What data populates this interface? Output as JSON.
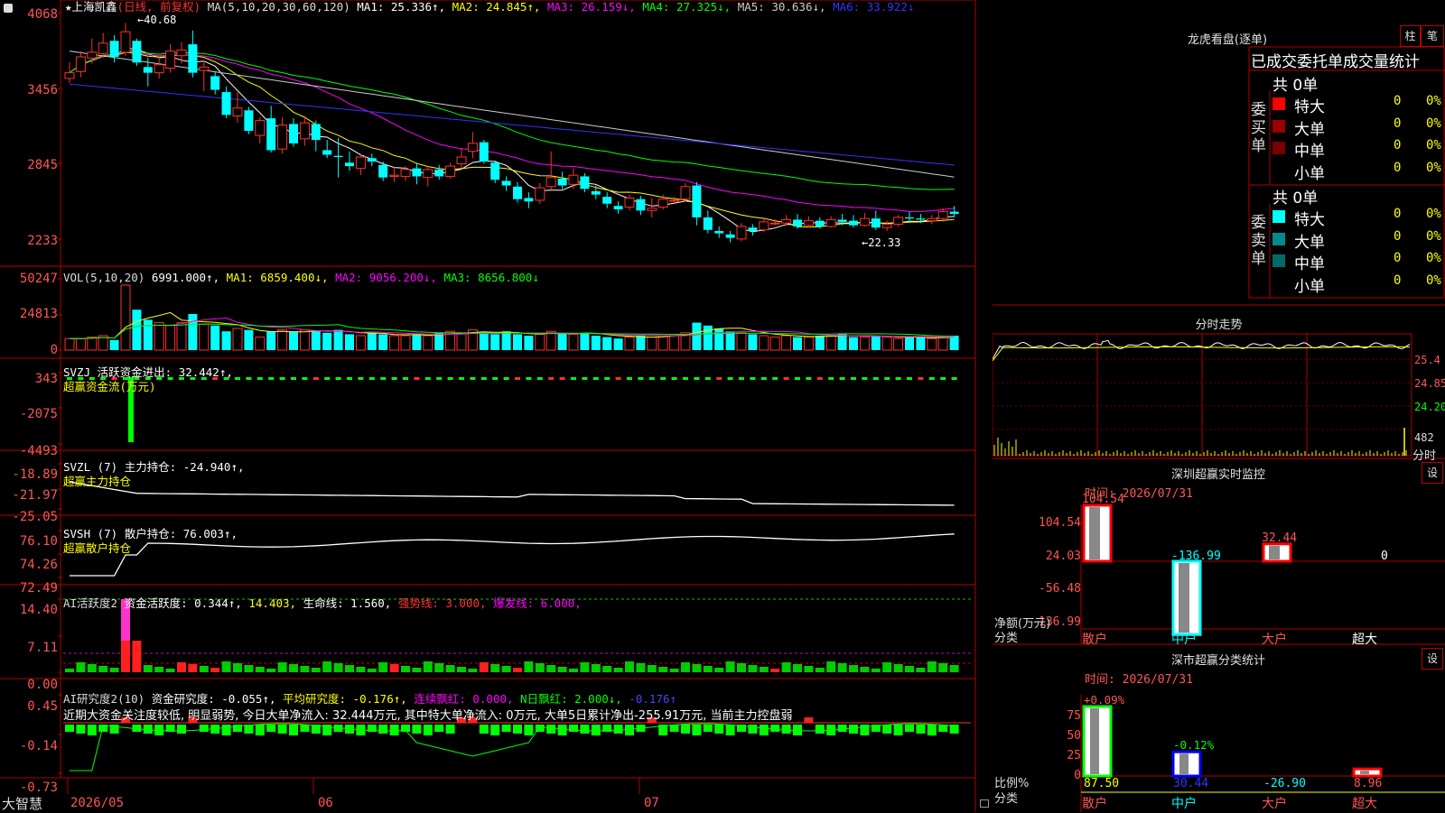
{
  "header": {
    "icon": "gear-icon",
    "star": "★",
    "stock_name": "上海凯鑫",
    "period_tag": "(日线, 前复权)",
    "ma_label": "MA(5,10,20,30,60,120)",
    "ma_items": [
      {
        "text": "MA1: 25.336↑,",
        "color": "#ffffff"
      },
      {
        "text": "MA2: 24.845↑,",
        "color": "#ffff00"
      },
      {
        "text": "MA3: 26.159↓,",
        "color": "#ff00ff"
      },
      {
        "text": "MA4: 27.325↓,",
        "color": "#00ff00"
      },
      {
        "text": "MA5: 30.636↓,",
        "color": "#cccccc"
      },
      {
        "text": "MA6: 33.922↓",
        "color": "#3333ff"
      }
    ]
  },
  "price_axis": [
    "4068",
    "3456",
    "2845",
    "2233"
  ],
  "high_label": "40.68",
  "low_label": "22.33",
  "volume_panel": {
    "axis": [
      "50247",
      "24813",
      "0"
    ],
    "title_items": [
      {
        "text": "VOL(5,10,20)",
        "color": "#dddddd"
      },
      {
        "text": "6991.000↑,",
        "color": "#ffffff"
      },
      {
        "text": "MA1: 6859.400↓,",
        "color": "#ffff00"
      },
      {
        "text": "MA2: 9056.200↓,",
        "color": "#ff00ff"
      },
      {
        "text": "MA3: 8656.800↓",
        "color": "#00ff00"
      }
    ]
  },
  "svzj_panel": {
    "axis": [
      "343",
      "-2075",
      "-4493"
    ],
    "title": "SVZJ  活跃资金进出: 32.442↑,",
    "subtitle": "超赢资金流(万元)"
  },
  "svzl_panel": {
    "axis": [
      "-18.89",
      "-21.97",
      "-25.05"
    ],
    "title": "SVZL (7) 主力持仓: -24.940↑,",
    "subtitle": "超赢主力持仓"
  },
  "svsh_panel": {
    "axis": [
      "76.10",
      "74.26",
      "72.49"
    ],
    "title": "SVSH (7) 散户持仓: 76.003↑,",
    "subtitle": "超赢散户持仓"
  },
  "ai_active_panel": {
    "axis": [
      "14.40",
      "7.11",
      "0.00"
    ],
    "title_items": [
      {
        "text": "AI活跃度2",
        "color": "#dddddd"
      },
      {
        "text": "资金活跃度: 0.344↑,",
        "color": "#ffffff"
      },
      {
        "text": "14.403,",
        "color": "#ffff00"
      },
      {
        "text": "生命线: 1.560,",
        "color": "#ffffff"
      },
      {
        "text": "强势线: 3.000,",
        "color": "#ff3333"
      },
      {
        "text": "爆发线: 6.000,",
        "color": "#ff00ff"
      }
    ]
  },
  "ai_research_panel": {
    "axis": [
      "0.45",
      "-0.14",
      "-0.73"
    ],
    "title_items": [
      {
        "text": "AI研究度2(10)",
        "color": "#dddddd"
      },
      {
        "text": "资金研究度: -0.055↑,",
        "color": "#ffffff"
      },
      {
        "text": "平均研究度: -0.176↑,",
        "color": "#ffff00"
      },
      {
        "text": "连续飘红: 0.000,",
        "color": "#ff00ff"
      },
      {
        "text": "N日飘红: 2.000↓,",
        "color": "#00ff00"
      },
      {
        "text": "-0.176↑",
        "color": "#4444ff"
      }
    ],
    "commentary": "近期大资金关注度较低, 明显弱势, 今日大单净流入: 32.444万元, 其中特大单净流入: 0万元, 大单5日累计净出-255.91万元, 当前主力控盘弱"
  },
  "date_axis": [
    "2026/05",
    "06",
    "07"
  ],
  "footer_brand": "大智慧",
  "right_panel": {
    "dragon_tiger": {
      "title": "龙虎看盘(逐单)",
      "btn_bar": "柱",
      "btn_pen": "笔",
      "tabs": "已成交委托单成交量统计",
      "buy_side_label": "委买单",
      "sell_side_label": "委卖单",
      "buy_total": "共 0单",
      "sell_total": "共 0单",
      "buy_rows": [
        {
          "label": "特大",
          "count": "0",
          "pct": "0%",
          "color": "#ff0000"
        },
        {
          "label": "大单",
          "count": "0",
          "pct": "0%",
          "color": "#990000"
        },
        {
          "label": "中单",
          "count": "0",
          "pct": "0%",
          "color": "#770000"
        },
        {
          "label": "小单",
          "count": "0",
          "pct": "0%",
          "color": ""
        }
      ],
      "sell_rows": [
        {
          "label": "特大",
          "count": "0",
          "pct": "0%",
          "color": "#00ffff"
        },
        {
          "label": "大单",
          "count": "0",
          "pct": "0%",
          "color": "#008b8b"
        },
        {
          "label": "中单",
          "count": "0",
          "pct": "0%",
          "color": "#006b6b"
        },
        {
          "label": "小单",
          "count": "0",
          "pct": "0%",
          "color": ""
        }
      ]
    },
    "intraday": {
      "title": "分时走势",
      "axis": [
        "25.4",
        "24.85",
        "24.20"
      ],
      "vol_label": "482",
      "vol_sub": "分时"
    },
    "sz_monitor": {
      "title": "深圳超赢实时监控",
      "settings": "设",
      "time": "时间: 2026/07/31",
      "axis": [
        "104.54",
        "24.03",
        "-56.48",
        "-136.99"
      ],
      "y_caption": "净额(万元)",
      "x_caption": "分类",
      "categories": [
        "散户",
        "中户",
        "大户",
        "超大"
      ],
      "values": [
        104.54,
        -136.99,
        32.44,
        0
      ],
      "value_labels": [
        "104.54",
        "-136.99",
        "32.44",
        "0"
      ]
    },
    "sz_classify": {
      "title": "深市超赢分类统计",
      "settings": "设",
      "time": "时间: 2026/07/31",
      "axis": [
        "75",
        "50",
        "25",
        "0"
      ],
      "y_caption": "比例%",
      "x_caption": "分类",
      "categories": [
        "散户",
        "中户",
        "大户",
        "超大"
      ],
      "bar_values": [
        87.5,
        30.44,
        0,
        8.96
      ],
      "top_labels": [
        "+0.09%",
        "-0.12%",
        "",
        ""
      ],
      "bottom_labels": [
        "87.50",
        "30.44",
        "-26.90",
        "8.96"
      ]
    }
  },
  "chart_data": {
    "type": "candlestick",
    "title": "上海凯鑫 (日线, 前复权)",
    "x_axis_ticks": [
      "2026/05",
      "06",
      "07"
    ],
    "price_range": [
      22.33,
      40.68
    ],
    "ylim": [
      20.5,
      41.5
    ],
    "candles": [
      {
        "o": 35.8,
        "c": 36.3,
        "h": 37.2,
        "l": 35.4
      },
      {
        "o": 36.4,
        "c": 37.7,
        "h": 38.2,
        "l": 35.9
      },
      {
        "o": 37.6,
        "c": 38.1,
        "h": 39.3,
        "l": 37.1
      },
      {
        "o": 38.0,
        "c": 38.9,
        "h": 39.8,
        "l": 37.6
      },
      {
        "o": 39.1,
        "c": 37.7,
        "h": 39.6,
        "l": 37.2
      },
      {
        "o": 38.1,
        "c": 39.9,
        "h": 40.68,
        "l": 37.8
      },
      {
        "o": 39.1,
        "c": 37.2,
        "h": 39.3,
        "l": 36.9
      },
      {
        "o": 36.8,
        "c": 36.3,
        "h": 37.6,
        "l": 35.1
      },
      {
        "o": 36.3,
        "c": 37.0,
        "h": 37.7,
        "l": 35.8
      },
      {
        "o": 36.7,
        "c": 38.2,
        "h": 38.8,
        "l": 36.3
      },
      {
        "o": 37.8,
        "c": 38.3,
        "h": 39.0,
        "l": 37.1
      },
      {
        "o": 38.8,
        "c": 36.3,
        "h": 40.0,
        "l": 35.9
      },
      {
        "o": 36.5,
        "c": 36.8,
        "h": 37.4,
        "l": 34.7
      },
      {
        "o": 36.0,
        "c": 34.8,
        "h": 36.4,
        "l": 34.4
      },
      {
        "o": 34.6,
        "c": 32.6,
        "h": 35.1,
        "l": 32.3
      },
      {
        "o": 32.5,
        "c": 33.2,
        "h": 34.6,
        "l": 31.9
      },
      {
        "o": 33.0,
        "c": 31.2,
        "h": 33.3,
        "l": 30.9
      },
      {
        "o": 30.8,
        "c": 32.1,
        "h": 32.4,
        "l": 30.1
      },
      {
        "o": 32.3,
        "c": 29.5,
        "h": 33.4,
        "l": 29.3
      },
      {
        "o": 29.6,
        "c": 31.7,
        "h": 32.4,
        "l": 29.2
      },
      {
        "o": 31.8,
        "c": 30.1,
        "h": 32.3,
        "l": 29.8
      },
      {
        "o": 30.5,
        "c": 31.9,
        "h": 32.5,
        "l": 29.9
      },
      {
        "o": 31.8,
        "c": 30.4,
        "h": 32.1,
        "l": 29.4
      },
      {
        "o": 29.5,
        "c": 29.1,
        "h": 30.4,
        "l": 28.8
      },
      {
        "o": 29.0,
        "c": 28.9,
        "h": 30.6,
        "l": 27.1
      },
      {
        "o": 28.4,
        "c": 28.1,
        "h": 29.4,
        "l": 27.7
      },
      {
        "o": 27.9,
        "c": 28.9,
        "h": 29.2,
        "l": 27.3
      },
      {
        "o": 28.8,
        "c": 28.5,
        "h": 29.2,
        "l": 28.1
      },
      {
        "o": 28.2,
        "c": 27.1,
        "h": 28.5,
        "l": 26.8
      },
      {
        "o": 27.2,
        "c": 27.3,
        "h": 28.0,
        "l": 26.7
      },
      {
        "o": 27.2,
        "c": 27.8,
        "h": 28.1,
        "l": 26.8
      },
      {
        "o": 27.9,
        "c": 27.2,
        "h": 28.4,
        "l": 26.5
      },
      {
        "o": 27.1,
        "c": 27.8,
        "h": 28.1,
        "l": 26.3
      },
      {
        "o": 27.8,
        "c": 27.2,
        "h": 28.2,
        "l": 26.9
      },
      {
        "o": 27.2,
        "c": 28.1,
        "h": 28.4,
        "l": 27.0
      },
      {
        "o": 28.3,
        "c": 28.9,
        "h": 29.7,
        "l": 27.9
      },
      {
        "o": 29.4,
        "c": 30.1,
        "h": 31.1,
        "l": 28.8
      },
      {
        "o": 30.2,
        "c": 28.5,
        "h": 30.4,
        "l": 28.3
      },
      {
        "o": 28.4,
        "c": 26.9,
        "h": 28.6,
        "l": 26.6
      },
      {
        "o": 26.8,
        "c": 26.4,
        "h": 27.2,
        "l": 25.9
      },
      {
        "o": 26.3,
        "c": 25.2,
        "h": 26.7,
        "l": 24.9
      },
      {
        "o": 25.3,
        "c": 25.0,
        "h": 25.8,
        "l": 24.4
      },
      {
        "o": 25.1,
        "c": 26.2,
        "h": 26.6,
        "l": 24.8
      },
      {
        "o": 26.3,
        "c": 27.1,
        "h": 29.4,
        "l": 26.0
      },
      {
        "o": 27.0,
        "c": 26.4,
        "h": 27.6,
        "l": 26.1
      },
      {
        "o": 26.5,
        "c": 27.3,
        "h": 27.9,
        "l": 26.1
      },
      {
        "o": 27.2,
        "c": 26.1,
        "h": 27.5,
        "l": 25.8
      },
      {
        "o": 25.9,
        "c": 25.6,
        "h": 26.4,
        "l": 25.2
      },
      {
        "o": 25.4,
        "c": 24.8,
        "h": 25.8,
        "l": 24.4
      },
      {
        "o": 24.6,
        "c": 24.3,
        "h": 25.0,
        "l": 23.9
      },
      {
        "o": 24.5,
        "c": 25.3,
        "h": 25.6,
        "l": 24.2
      },
      {
        "o": 25.2,
        "c": 24.2,
        "h": 25.5,
        "l": 23.8
      },
      {
        "o": 24.2,
        "c": 24.4,
        "h": 25.3,
        "l": 23.6
      },
      {
        "o": 24.5,
        "c": 25.2,
        "h": 25.6,
        "l": 24.3
      },
      {
        "o": 25.1,
        "c": 25.1,
        "h": 25.4,
        "l": 24.8
      },
      {
        "o": 25.2,
        "c": 26.3,
        "h": 26.6,
        "l": 25.0
      },
      {
        "o": 26.4,
        "c": 23.6,
        "h": 26.7,
        "l": 22.9
      },
      {
        "o": 23.6,
        "c": 22.5,
        "h": 24.2,
        "l": 22.2
      },
      {
        "o": 22.4,
        "c": 22.2,
        "h": 22.8,
        "l": 21.8
      },
      {
        "o": 22.1,
        "c": 21.8,
        "h": 22.4,
        "l": 21.4
      },
      {
        "o": 21.7,
        "c": 22.8,
        "h": 23.1,
        "l": 21.5
      },
      {
        "o": 22.7,
        "c": 22.4,
        "h": 23.0,
        "l": 22.0
      },
      {
        "o": 22.5,
        "c": 23.2,
        "h": 23.5,
        "l": 22.3
      },
      {
        "o": 23.1,
        "c": 23.1,
        "h": 23.4,
        "l": 22.9
      },
      {
        "o": 23.1,
        "c": 23.4,
        "h": 23.8,
        "l": 22.9
      },
      {
        "o": 23.4,
        "c": 22.8,
        "h": 23.9,
        "l": 22.6
      },
      {
        "o": 22.9,
        "c": 23.3,
        "h": 23.7,
        "l": 22.7
      },
      {
        "o": 23.3,
        "c": 22.8,
        "h": 23.6,
        "l": 22.6
      },
      {
        "o": 22.8,
        "c": 23.4,
        "h": 23.7,
        "l": 22.7
      },
      {
        "o": 23.4,
        "c": 23.2,
        "h": 23.9,
        "l": 22.9
      },
      {
        "o": 23.3,
        "c": 22.9,
        "h": 23.8,
        "l": 22.7
      },
      {
        "o": 22.9,
        "c": 23.5,
        "h": 24.0,
        "l": 22.8
      },
      {
        "o": 23.5,
        "c": 22.7,
        "h": 24.2,
        "l": 22.5
      },
      {
        "o": 22.7,
        "c": 23.0,
        "h": 23.3,
        "l": 22.4
      },
      {
        "o": 23.0,
        "c": 23.6,
        "h": 23.8,
        "l": 22.8
      },
      {
        "o": 23.6,
        "c": 23.5,
        "h": 24.1,
        "l": 23.2
      },
      {
        "o": 23.5,
        "c": 23.4,
        "h": 23.9,
        "l": 23.1
      },
      {
        "o": 23.3,
        "c": 23.5,
        "h": 23.8,
        "l": 23.0
      },
      {
        "o": 23.5,
        "c": 24.1,
        "h": 24.4,
        "l": 23.2
      },
      {
        "o": 24.1,
        "c": 23.9,
        "h": 24.6,
        "l": 23.6
      }
    ],
    "volume": [
      8,
      8,
      9,
      10,
      7,
      45,
      28,
      21,
      19,
      17,
      19,
      25,
      18,
      17,
      13,
      15,
      14,
      9,
      13,
      14,
      13,
      14,
      13,
      12,
      14,
      11,
      10,
      12,
      11,
      10,
      10,
      11,
      10,
      12,
      13,
      12,
      14,
      12,
      11,
      13,
      11,
      10,
      11,
      13,
      12,
      11,
      12,
      10,
      9,
      8,
      9,
      10,
      9,
      10,
      11,
      12,
      19,
      17,
      15,
      13,
      12,
      11,
      10,
      9,
      10,
      9,
      9,
      10,
      10,
      11,
      9,
      9,
      10,
      9,
      8,
      9,
      9,
      8,
      9,
      10
    ],
    "ma_series_colors": [
      "#ffffff",
      "#ffff00",
      "#ff00ff",
      "#00ff00",
      "#cccccc",
      "#3333ff"
    ]
  }
}
